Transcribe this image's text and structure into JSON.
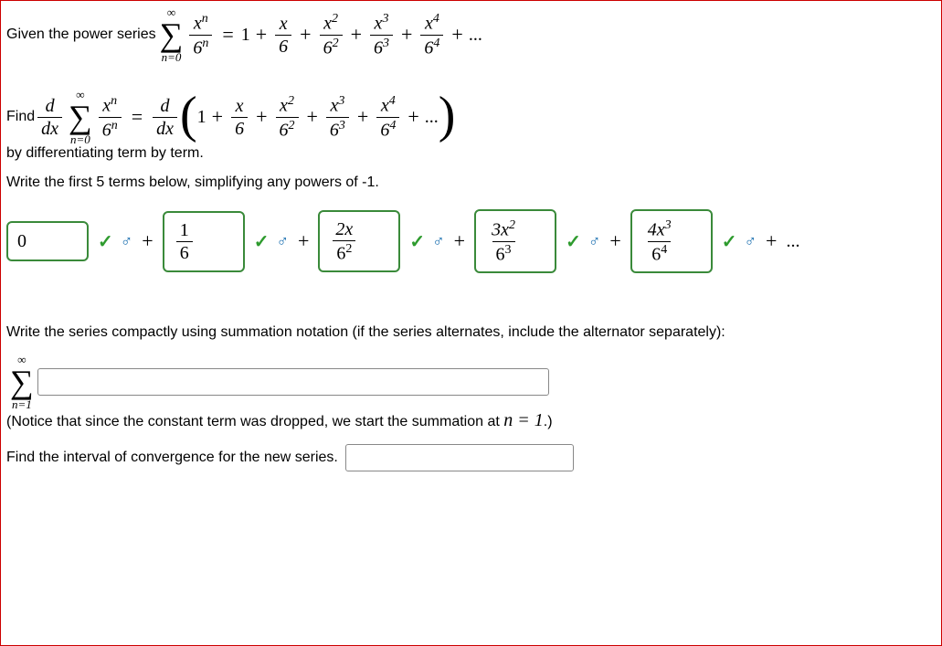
{
  "given_text": "Given the power series ",
  "series_given": {
    "sum_top": "∞",
    "sum_bot": "n=0",
    "frac_num": "xⁿ",
    "frac_den": "6ⁿ",
    "expansion_lead": "1",
    "terms": [
      {
        "num": "x",
        "den": "6"
      },
      {
        "num": "x²",
        "den": "6²"
      },
      {
        "num": "x³",
        "den": "6³"
      },
      {
        "num": "x⁴",
        "den": "6⁴"
      }
    ],
    "trail": "..."
  },
  "find_text": "Find ",
  "deriv": {
    "d_over_dx_num": "d",
    "d_over_dx_den": "dx",
    "sum_top": "∞",
    "sum_bot": "n=0",
    "frac_num": "xⁿ",
    "frac_den": "6ⁿ",
    "expansion_lead": "1",
    "terms": [
      {
        "num": "x",
        "den": "6"
      },
      {
        "num": "x²",
        "den": "6²"
      },
      {
        "num": "x³",
        "den": "6³"
      },
      {
        "num": "x⁴",
        "den": "6⁴"
      }
    ],
    "trail": "..."
  },
  "diff_instruction": "by differentiating term by term.",
  "write_terms": "Write the first 5 terms below, simplifying any powers of -1.",
  "answers": [
    {
      "num": "0",
      "den": ""
    },
    {
      "num": "1",
      "den": "6"
    },
    {
      "num": "2x",
      "den": "6²"
    },
    {
      "num": "3x²",
      "den": "6³"
    },
    {
      "num": "4x³",
      "den": "6⁴"
    }
  ],
  "answer_trail": "...",
  "compact_instruction": "Write the series compactly using summation notation (if the series alternates, include the alternator separately):",
  "compact_sum_top": "∞",
  "compact_sum_bot": "n=1",
  "compact_input": "",
  "notice_text": "(Notice that since the constant term was dropped, we start the summation at ",
  "notice_math": "n = 1",
  "notice_end": ".)",
  "interval_text": "Find the interval of convergence for the new series.",
  "interval_input": "",
  "plus_sign": "+",
  "eq_sign": "=",
  "check_mark": "✓",
  "link_glyph": "♂"
}
